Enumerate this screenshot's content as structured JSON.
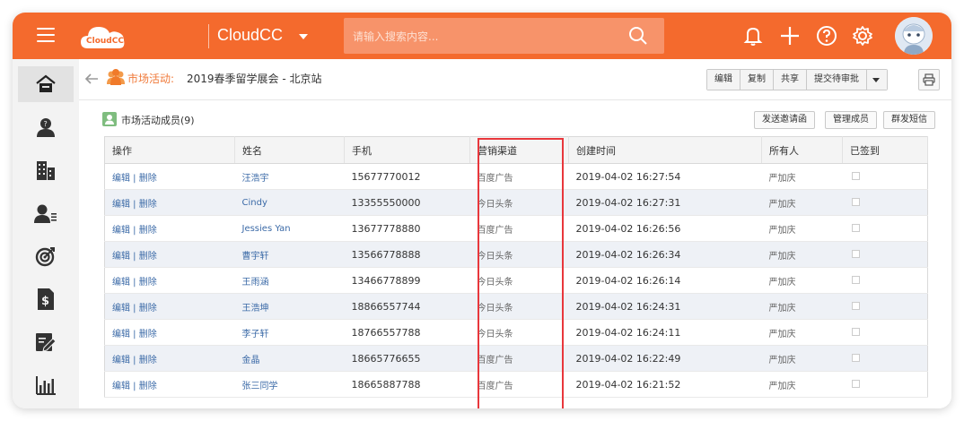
{
  "topbar": {
    "logo_text": "CloudCC",
    "app_name": "CloudCC",
    "search_placeholder": "请输入搜索内容...",
    "accent_color": "#f46a2d"
  },
  "sidebar": {
    "items": [
      {
        "icon": "home-icon",
        "active": true
      },
      {
        "icon": "user-question-icon"
      },
      {
        "icon": "building-icon"
      },
      {
        "icon": "contact-list-icon"
      },
      {
        "icon": "target-icon"
      },
      {
        "icon": "dollar-document-icon"
      },
      {
        "icon": "edit-document-icon"
      },
      {
        "icon": "bar-chart-icon"
      }
    ]
  },
  "breadcrumb": {
    "label": "市场活动:",
    "title": "2019春季留学展会 - 北京站"
  },
  "actions": {
    "edit": "编辑",
    "copy": "复制",
    "share": "共享",
    "submit_approval": "提交待审批"
  },
  "section": {
    "title": "市场活动成员(9)",
    "send_invite": "发送邀请函",
    "manage_members": "管理成员",
    "bulk_sms": "群发短信"
  },
  "table": {
    "columns": [
      "操作",
      "姓名",
      "手机",
      "营销渠道",
      "创建时间",
      "所有人",
      "已签到"
    ],
    "op_label": "编辑 | 删除",
    "rows": [
      {
        "name": "汪浩宇",
        "phone": "15677770012",
        "channel": "百度广告",
        "created": "2019-04-02 16:27:54",
        "owner": "严加庆"
      },
      {
        "name": "Cindy",
        "phone": "13355550000",
        "channel": "今日头条",
        "created": "2019-04-02 16:27:31",
        "owner": "严加庆"
      },
      {
        "name": "Jessies Yan",
        "phone": "13677778880",
        "channel": "百度广告",
        "created": "2019-04-02 16:26:56",
        "owner": "严加庆"
      },
      {
        "name": "曹宇轩",
        "phone": "13566778888",
        "channel": "今日头条",
        "created": "2019-04-02 16:26:34",
        "owner": "严加庆"
      },
      {
        "name": "王雨涵",
        "phone": "13466778899",
        "channel": "今日头条",
        "created": "2019-04-02 16:26:14",
        "owner": "严加庆"
      },
      {
        "name": "王浩坤",
        "phone": "18866557744",
        "channel": "今日头条",
        "created": "2019-04-02 16:24:31",
        "owner": "严加庆"
      },
      {
        "name": "李子轩",
        "phone": "18766557788",
        "channel": "今日头条",
        "created": "2019-04-02 16:24:11",
        "owner": "严加庆"
      },
      {
        "name": "金晶",
        "phone": "18665776655",
        "channel": "百度广告",
        "created": "2019-04-02 16:22:49",
        "owner": "严加庆"
      },
      {
        "name": "张三同学",
        "phone": "18665887788",
        "channel": "百度广告",
        "created": "2019-04-02 16:21:52",
        "owner": "严加庆"
      }
    ]
  },
  "highlight_color": "#e8373c"
}
